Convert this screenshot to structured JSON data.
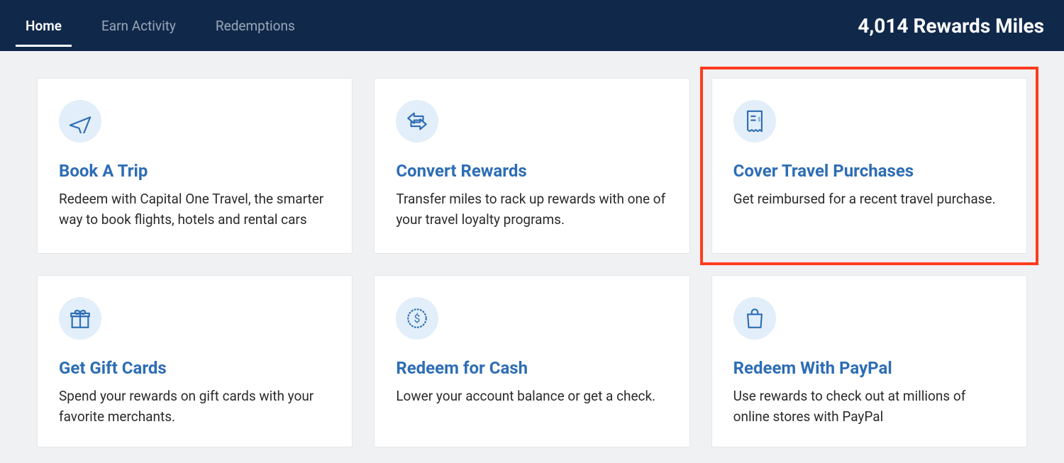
{
  "header": {
    "tabs": [
      {
        "label": "Home",
        "active": true
      },
      {
        "label": "Earn Activity",
        "active": false
      },
      {
        "label": "Redemptions",
        "active": false
      }
    ],
    "miles_text": "4,014 Rewards Miles"
  },
  "cards": [
    {
      "id": "book-a-trip",
      "icon": "airplane-icon",
      "title": "Book A Trip",
      "desc": "Redeem with Capital One Travel, the smarter way to book flights, hotels and rental cars",
      "highlighted": false
    },
    {
      "id": "convert-rewards",
      "icon": "convert-icon",
      "title": "Convert Rewards",
      "desc": "Transfer miles to rack up rewards with one of your travel loyalty programs.",
      "highlighted": false
    },
    {
      "id": "cover-travel-purchases",
      "icon": "receipt-icon",
      "title": "Cover Travel Purchases",
      "desc": "Get reimbursed for a recent travel purchase.",
      "highlighted": true
    },
    {
      "id": "get-gift-cards",
      "icon": "gift-icon",
      "title": "Get Gift Cards",
      "desc": "Spend your rewards on gift cards with your favorite merchants.",
      "highlighted": false
    },
    {
      "id": "redeem-for-cash",
      "icon": "cash-icon",
      "title": "Redeem for Cash",
      "desc": "Lower your account balance or get a check.",
      "highlighted": false
    },
    {
      "id": "redeem-with-paypal",
      "icon": "shopping-bag-icon",
      "title": "Redeem With PayPal",
      "desc": "Use rewards to check out at millions of online stores with PayPal",
      "highlighted": false
    }
  ]
}
